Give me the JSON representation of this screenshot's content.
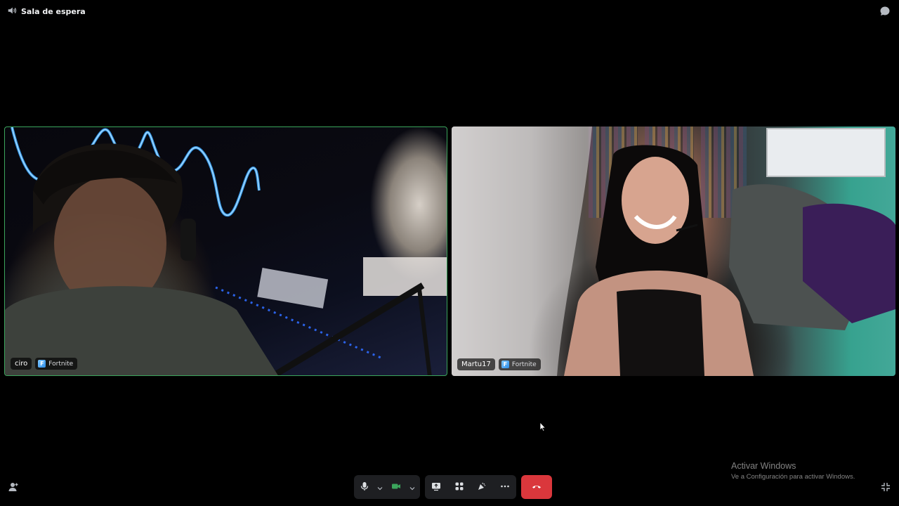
{
  "header": {
    "channel_icon": "speaker-icon",
    "channel_name": "Sala de espera",
    "chat_icon": "chat-bubble-icon"
  },
  "participants": [
    {
      "name": "ciro",
      "activity": "Fortnite",
      "speaking": true,
      "speaking_color": "#3ba55c"
    },
    {
      "name": "Martu17",
      "activity": "Fortnite",
      "speaking": false
    }
  ],
  "controls": {
    "microphone_icon": "microphone-icon",
    "camera_icon": "camera-icon",
    "camera_on_color": "#3ba55c",
    "screen_share_icon": "screen-share-icon",
    "activities_icon": "activities-icon",
    "soundboard_icon": "soundboard-icon",
    "more_icon": "more-icon",
    "disconnect_icon": "hang-up-icon",
    "disconnect_color": "#da373c",
    "invite_icon": "add-person-icon",
    "fullscreen_icon": "exit-fullscreen-icon"
  },
  "watermark": {
    "title": "Activar Windows",
    "subtitle": "Ve a Configuración para activar Windows."
  }
}
